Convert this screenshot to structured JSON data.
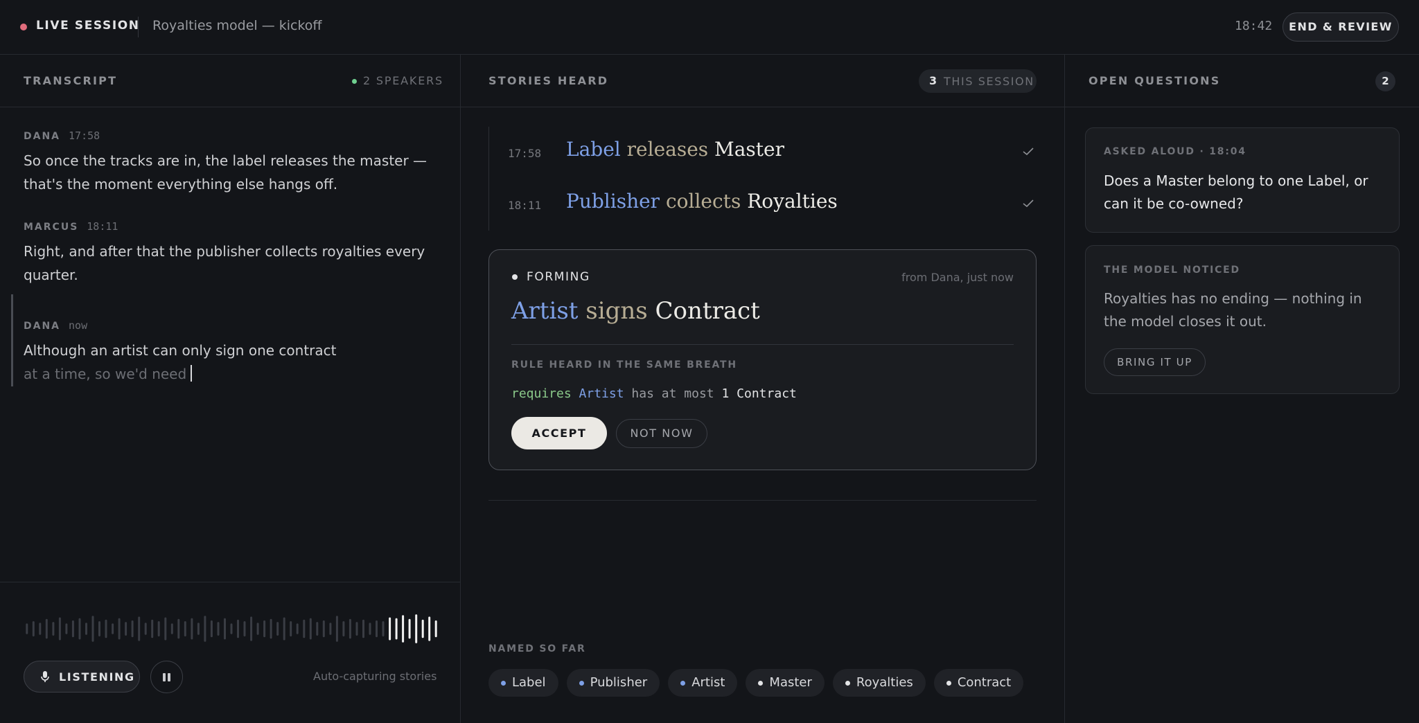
{
  "header": {
    "live_label": "LIVE SESSION",
    "session_title": "Royalties model — kickoff",
    "clock": "18:42",
    "end_button": "END & REVIEW",
    "live_color": "#e06c7c"
  },
  "transcript": {
    "title": "TRANSCRIPT",
    "speakers": "2 SPEAKERS",
    "entries": [
      {
        "speaker": "DANA",
        "time": "17:58",
        "text": "So once the tracks are in, the label releases the master — that's the moment everything else hangs off."
      },
      {
        "speaker": "MARCUS",
        "time": "18:11",
        "text": "Right, and after that the publisher collects royalties every quarter."
      }
    ],
    "live_entry": {
      "speaker": "DANA",
      "time": "now",
      "text": "Although an artist can only sign one contract",
      "pending": "at a time, so we'd need"
    },
    "listening": "LISTENING",
    "auto_capture": "Auto-capturing stories",
    "wave_levels": [
      0.35,
      0.5,
      0.4,
      0.65,
      0.45,
      0.75,
      0.35,
      0.55,
      0.7,
      0.4,
      0.85,
      0.5,
      0.6,
      0.35,
      0.7,
      0.45,
      0.55,
      0.8,
      0.4,
      0.6,
      0.5,
      0.75,
      0.35,
      0.65,
      0.5,
      0.7,
      0.4,
      0.85,
      0.55,
      0.45,
      0.7,
      0.35,
      0.6,
      0.5,
      0.8,
      0.4,
      0.55,
      0.65,
      0.45,
      0.75,
      0.5,
      0.35,
      0.6,
      0.7,
      0.45,
      0.55,
      0.4,
      0.85,
      0.5,
      0.65,
      0.45,
      0.6,
      0.4,
      0.55,
      0.5,
      0.75,
      0.7,
      0.9,
      0.65,
      0.95,
      0.6,
      0.8,
      0.55
    ],
    "wave_active_from": 55
  },
  "stories": {
    "title": "STORIES HEARD",
    "count": "3",
    "count_label": "THIS SESSION",
    "items": [
      {
        "time": "17:58",
        "subject": "Label",
        "verb": "releases",
        "object": "Master"
      },
      {
        "time": "18:11",
        "subject": "Publisher",
        "verb": "collects",
        "object": "Royalties"
      }
    ],
    "forming": {
      "label": "FORMING",
      "source": "from Dana, just now",
      "subject": "Artist",
      "verb": "signs",
      "object": "Contract",
      "rule_label": "RULE HEARD IN THE SAME BREATH",
      "rule_keyword": "requires",
      "rule_entity": "Artist",
      "rule_mid": "has at most",
      "rule_count": "1",
      "rule_object": "Contract",
      "accept": "ACCEPT",
      "not_now": "NOT NOW"
    },
    "named_label": "NAMED SO FAR",
    "named": [
      {
        "label": "Label",
        "color": "#7ea0e6"
      },
      {
        "label": "Publisher",
        "color": "#7ea0e6"
      },
      {
        "label": "Artist",
        "color": "#7ea0e6"
      },
      {
        "label": "Master",
        "color": "#e3e4e6"
      },
      {
        "label": "Royalties",
        "color": "#e3e4e6"
      },
      {
        "label": "Contract",
        "color": "#e3e4e6"
      }
    ]
  },
  "questions": {
    "title": "OPEN QUESTIONS",
    "count": "2",
    "asked": {
      "label": "ASKED ALOUD · 18:04",
      "text": "Does a Master belong to one Label, or can it be co-owned?"
    },
    "noticed": {
      "label": "THE MODEL NOTICED",
      "text": "Royalties has no ending — nothing in the model closes it out.",
      "button": "BRING IT UP"
    }
  }
}
